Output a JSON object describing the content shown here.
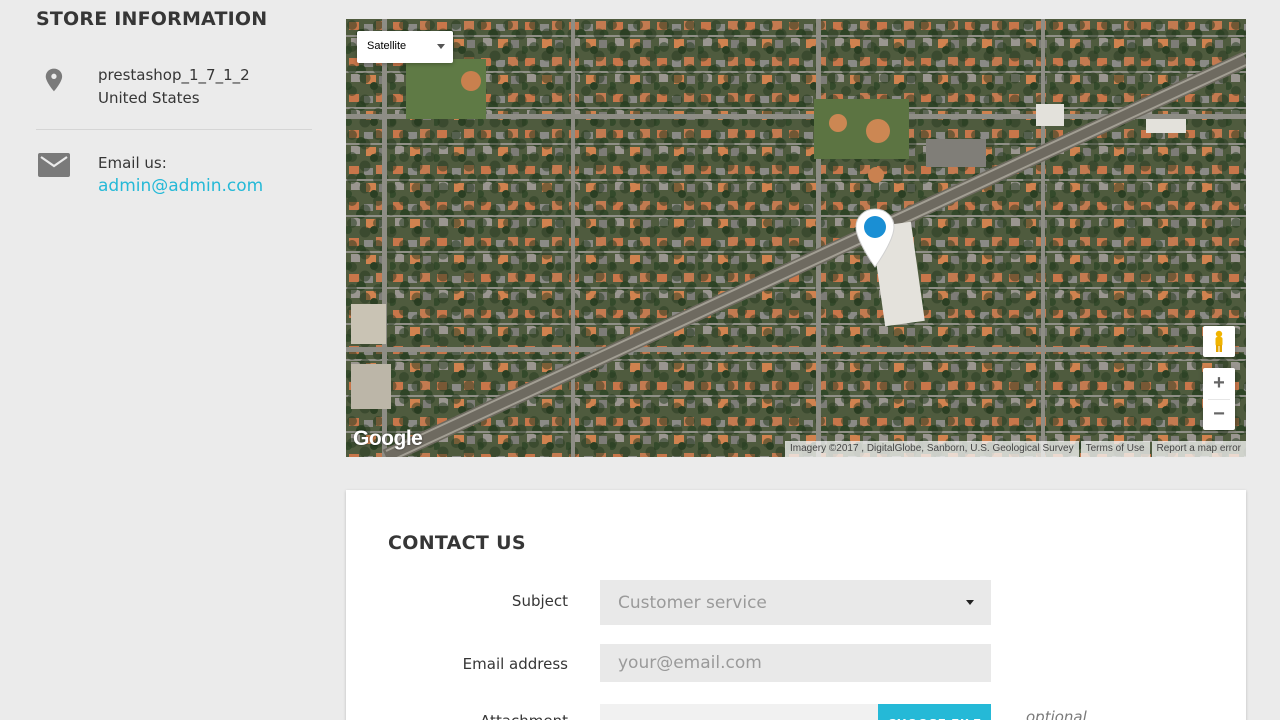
{
  "store": {
    "title": "STORE INFORMATION",
    "address_line1": "prestashop_1_7_1_2",
    "address_line2": "United States",
    "email_label": "Email us:",
    "email": "admin@admin.com"
  },
  "map": {
    "type_selected": "Satellite",
    "logo": "Google",
    "attribution": "Imagery ©2017 , DigitalGlobe, Sanborn, U.S. Geological Survey",
    "terms": "Terms of Use",
    "report": "Report a map error",
    "zoom_in": "+",
    "zoom_out": "−"
  },
  "contact": {
    "title": "CONTACT US",
    "subject_label": "Subject",
    "subject_value": "Customer service",
    "email_label": "Email address",
    "email_placeholder": "your@email.com",
    "attachment_label": "Attachment",
    "choose_file": "CHOOSE FILE",
    "optional": "optional"
  },
  "colors": {
    "accent": "#25b9d7",
    "background": "#ebebeb",
    "marker": "#1a8fd4"
  },
  "icons": [
    "location-pin-icon",
    "mail-icon",
    "chevron-down-icon",
    "pegman-icon",
    "map-marker-icon"
  ]
}
